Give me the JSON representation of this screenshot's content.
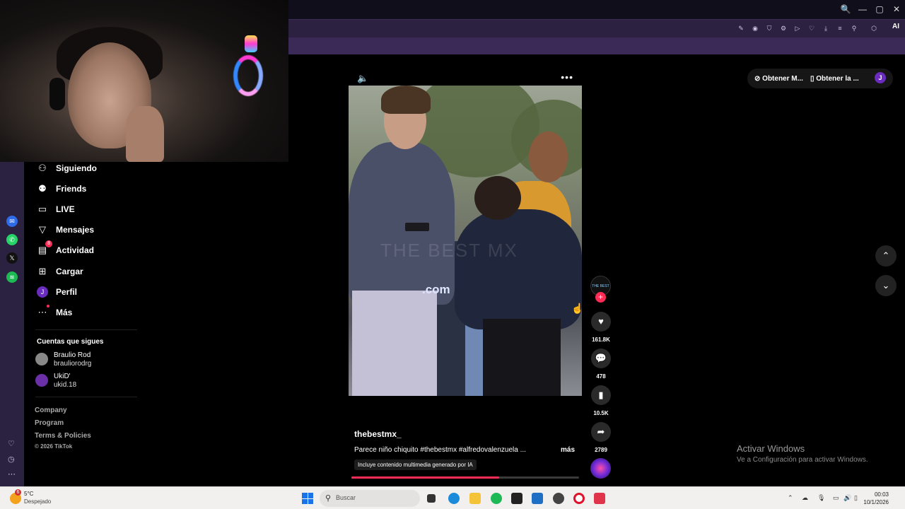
{
  "browser": {
    "window_controls": [
      "🔍",
      "—",
      "▢",
      "✕"
    ],
    "ai_label": "AI"
  },
  "opera_sidebar": {
    "icons": [
      "messenger-icon",
      "whatsapp-icon",
      "x-icon",
      "spotify-icon"
    ],
    "bottom_icons": [
      "heart-icon",
      "history-icon",
      "more-icon"
    ],
    "bottom_glyphs": [
      "♡",
      "◷",
      "⋯"
    ]
  },
  "nav": {
    "items": [
      {
        "label": "Siguiendo",
        "icon": "person-plus-icon",
        "glyph": "👤"
      },
      {
        "label": "Friends",
        "icon": "friends-icon",
        "glyph": "👥"
      },
      {
        "label": "LIVE",
        "icon": "live-tv-icon",
        "glyph": "📺"
      },
      {
        "label": "Mensajes",
        "icon": "messages-icon",
        "glyph": "▽"
      },
      {
        "label": "Actividad",
        "icon": "activity-icon",
        "glyph": "▤",
        "badge": "8"
      },
      {
        "label": "Cargar",
        "icon": "upload-icon",
        "glyph": "⊞"
      },
      {
        "label": "Perfil",
        "icon": "profile-avatar",
        "glyph": "J"
      },
      {
        "label": "Más",
        "icon": "more-icon",
        "glyph": "⋯"
      }
    ],
    "following_heading": "Cuentas que sigues",
    "following": [
      {
        "name": "Braulio Rod",
        "handle": "brauliorodrg"
      },
      {
        "name": "UkiD'",
        "handle": "ukid.18"
      }
    ],
    "footer_links": [
      "Company",
      "Program",
      "Terms & Policies"
    ],
    "copyright": "© 2026 TikTok"
  },
  "video": {
    "author": "thebestmx_",
    "description": "Parece niño chiquito #thebestmx #alfredovalenzuela ...",
    "more_label": "más",
    "ai_label": "Incluye contenido multimedia generado por IA",
    "overlay_text": ".com",
    "watermark": "THE BEST MX",
    "progress": 0.65
  },
  "actions": {
    "likes": "161.8K",
    "comments": "478",
    "saves": "10.5K",
    "shares": "2789",
    "creator_avatar_text": "THE BEST"
  },
  "top_right": {
    "get_app_1": "Obtener M...",
    "get_app_2": "Obtener la ...",
    "avatar_letter": "J"
  },
  "activate": {
    "title": "Activar Windows",
    "subtitle": "Ve a Configuración para activar Windows."
  },
  "taskbar": {
    "weather_badge": "6",
    "temperature": "5°C",
    "weather_desc": "Despejado",
    "search_placeholder": "Buscar",
    "time": "00:03",
    "date": "10/1/2026"
  },
  "colors": {
    "accent": "#fe2c55",
    "browser_toolbar": "#2c2140",
    "sidebar": "#2b2140"
  }
}
